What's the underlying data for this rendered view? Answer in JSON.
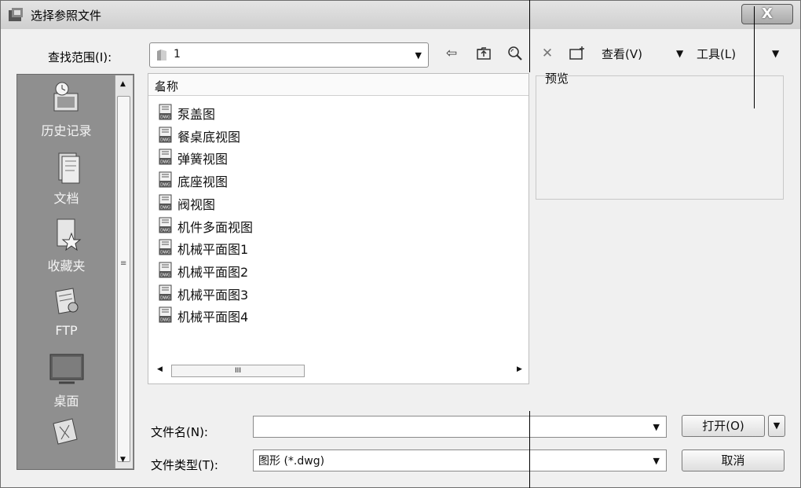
{
  "window": {
    "title": "选择参照文件",
    "close_glyph": "X"
  },
  "lookin": {
    "label": "查找范围(I):",
    "value": "1"
  },
  "toolbar": {
    "view_label": "查看(V)",
    "tools_label": "工具(L)"
  },
  "sidebar": {
    "items": [
      {
        "label": "历史记录",
        "icon": "history-icon"
      },
      {
        "label": "文档",
        "icon": "documents-icon"
      },
      {
        "label": "收藏夹",
        "icon": "favorites-icon"
      },
      {
        "label": "FTP",
        "icon": "ftp-icon"
      },
      {
        "label": "桌面",
        "icon": "desktop-icon"
      }
    ]
  },
  "filelist": {
    "column_header": "名称",
    "files": [
      "泵盖图",
      "餐桌底视图",
      "弹簧视图",
      "底座视图",
      "阀视图",
      "机件多面视图",
      "机械平面图1",
      "机械平面图2",
      "机械平面图3",
      "机械平面图4"
    ],
    "scroll_grip": "III"
  },
  "preview": {
    "label": "预览"
  },
  "filename": {
    "label": "文件名(N):",
    "value": ""
  },
  "filetype": {
    "label": "文件类型(T):",
    "value": "图形 (*.dwg)"
  },
  "buttons": {
    "open": "打开(O)",
    "cancel": "取消"
  }
}
